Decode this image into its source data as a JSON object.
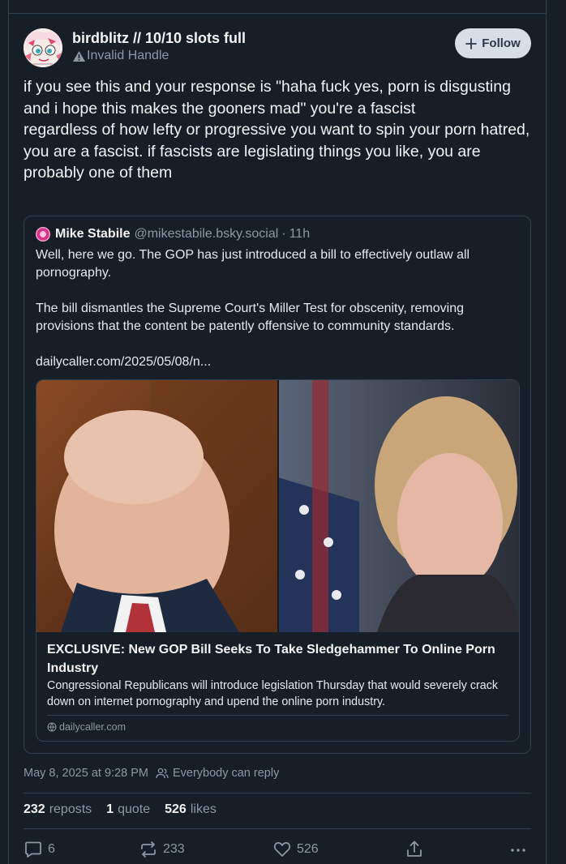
{
  "author": {
    "display_name": "birdblitz // 10/10 slots full",
    "handle_status": "Invalid Handle"
  },
  "follow_button": {
    "label": "Follow"
  },
  "post": {
    "paragraphs": [
      "if you see this and your response is \"haha fuck yes, porn is disgusting and i hope this makes the gooners mad\" you're a fascist",
      "regardless of how lefty or progressive you want to spin your porn hatred, you are a fascist. if fascists are legislating things you like, you are probably one of them"
    ]
  },
  "quoted_post": {
    "author_name": "Mike Stabile",
    "author_handle": "@mikestabile.bsky.social",
    "separator": "·",
    "time": "11h",
    "paragraphs": [
      "Well, here we go. The GOP has just introduced a bill to effectively outlaw all pornography.",
      "The bill dismantles the Supreme Court's Miller Test for obscenity, removing provisions that the content be patently offensive to community standards.",
      "dailycaller.com/2025/05/08/n..."
    ],
    "link_card": {
      "title": "EXCLUSIVE: New GOP Bill Seeks To Take Sledgehammer To Online Porn Industry",
      "description": "Congressional Republicans will introduce legislation Thursday that would severely crack down on internet pornography and upend the online porn industry.",
      "domain": "dailycaller.com"
    }
  },
  "meta": {
    "timestamp": "May 8, 2025 at 9:28 PM",
    "reply_setting": "Everybody can reply"
  },
  "stats": {
    "reposts_count": "232",
    "reposts_label": "reposts",
    "quotes_count": "1",
    "quotes_label": "quote",
    "likes_count": "526",
    "likes_label": "likes"
  },
  "actions": {
    "reply_count": "6",
    "repost_count": "233",
    "like_count": "526"
  },
  "icons": [
    "warning-icon",
    "plus-icon",
    "people-icon",
    "globe-icon",
    "reply-icon",
    "repost-icon",
    "heart-icon",
    "share-icon",
    "more-icon"
  ],
  "colors": {
    "background": "#161e27",
    "border": "#2e4052",
    "muted_text": "#8b98a5",
    "follow_button_bg": "#d6dfe8"
  }
}
